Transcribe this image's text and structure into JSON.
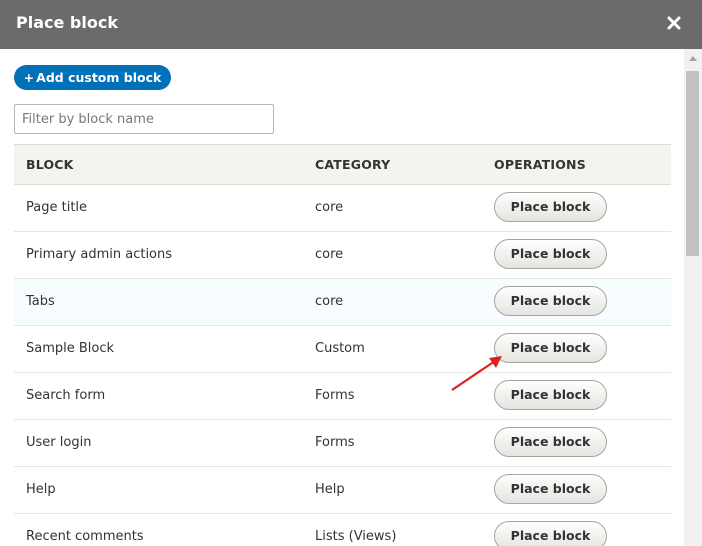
{
  "dialog": {
    "title": "Place block",
    "close_icon": "close-icon"
  },
  "toolbar": {
    "add_custom_block_label": "Add custom block",
    "add_icon": "plus-icon"
  },
  "filter": {
    "placeholder": "Filter by block name",
    "value": ""
  },
  "table": {
    "headers": {
      "block": "BLOCK",
      "category": "CATEGORY",
      "operations": "OPERATIONS"
    },
    "rows": [
      {
        "block": "Page title",
        "category": "core",
        "operation": "Place block"
      },
      {
        "block": "Primary admin actions",
        "category": "core",
        "operation": "Place block"
      },
      {
        "block": "Tabs",
        "category": "core",
        "operation": "Place block"
      },
      {
        "block": "Sample Block",
        "category": "Custom",
        "operation": "Place block"
      },
      {
        "block": "Search form",
        "category": "Forms",
        "operation": "Place block"
      },
      {
        "block": "User login",
        "category": "Forms",
        "operation": "Place block"
      },
      {
        "block": "Help",
        "category": "Help",
        "operation": "Place block"
      },
      {
        "block": "Recent comments",
        "category": "Lists (Views)",
        "operation": "Place block"
      }
    ]
  },
  "colors": {
    "titlebar": "#6b6b6b",
    "primary_button": "#0071b8",
    "annotation_arrow": "#e0201e"
  }
}
